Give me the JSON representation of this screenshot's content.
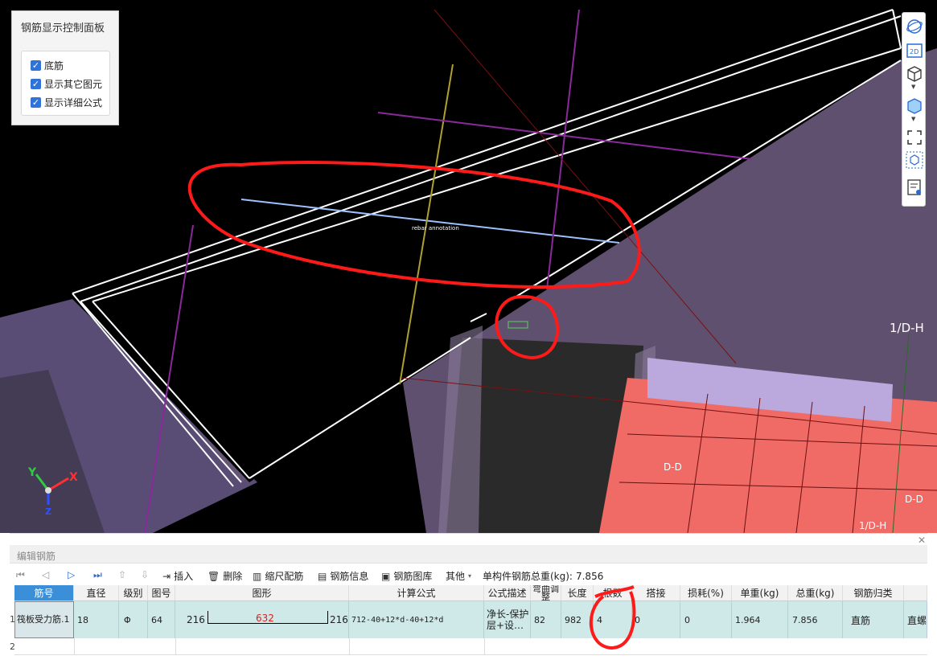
{
  "control_panel": {
    "title": "钢筋显示控制面板",
    "options": [
      {
        "label": "底筋",
        "checked": true
      },
      {
        "label": "显示其它图元",
        "checked": true
      },
      {
        "label": "显示详细公式",
        "checked": true
      }
    ]
  },
  "scene": {
    "axis_label_right": "1/D-H",
    "grid_label_1": "D-D",
    "grid_label_2": "D-D",
    "grid_label_3": "1/D-H"
  },
  "axes": {
    "x": "X",
    "y": "Y",
    "z": "Z"
  },
  "right_toolbar": {
    "icons": [
      "orbit-icon",
      "2d-view-icon",
      "cube-view-icon",
      "cube-solid-icon",
      "fullscreen-icon",
      "3d-box-icon",
      "report-icon"
    ],
    "label_2d": "2D"
  },
  "edit_panel": {
    "title": "编辑钢筋",
    "toolbar": {
      "insert": "插入",
      "delete": "删除",
      "scale_rebar": "缩尺配筋",
      "rebar_info": "钢筋信息",
      "rebar_library": "钢筋图库",
      "other": "其他",
      "total_weight_label": "单构件钢筋总重(kg):",
      "total_weight_value": "7.856"
    },
    "table": {
      "headers": [
        "筋号",
        "直径(mm)",
        "级别",
        "图号",
        "图形",
        "计算公式",
        "公式描述",
        "弯曲调整",
        "长度",
        "根数",
        "搭接",
        "损耗(%)",
        "单重(kg)",
        "总重(kg)",
        "钢筋归类",
        ""
      ],
      "rows": [
        {
          "row_num": "1",
          "bar_no": "筏板受力筋.1",
          "diameter": "18",
          "grade": "Φ",
          "shape_no": "64",
          "shape_left": "216",
          "shape_mid": "632",
          "shape_right": "216",
          "formula": "712-40+12*d-40+12*d",
          "formula_desc": "净长-保护层+设…",
          "bend_adjust": "82",
          "length": "982",
          "count": "4",
          "lap": "0",
          "loss": "0",
          "unit_weight": "1.964",
          "total_weight": "7.856",
          "category": "直筋",
          "extra": "直螺"
        }
      ],
      "row2_num": "2"
    }
  }
}
